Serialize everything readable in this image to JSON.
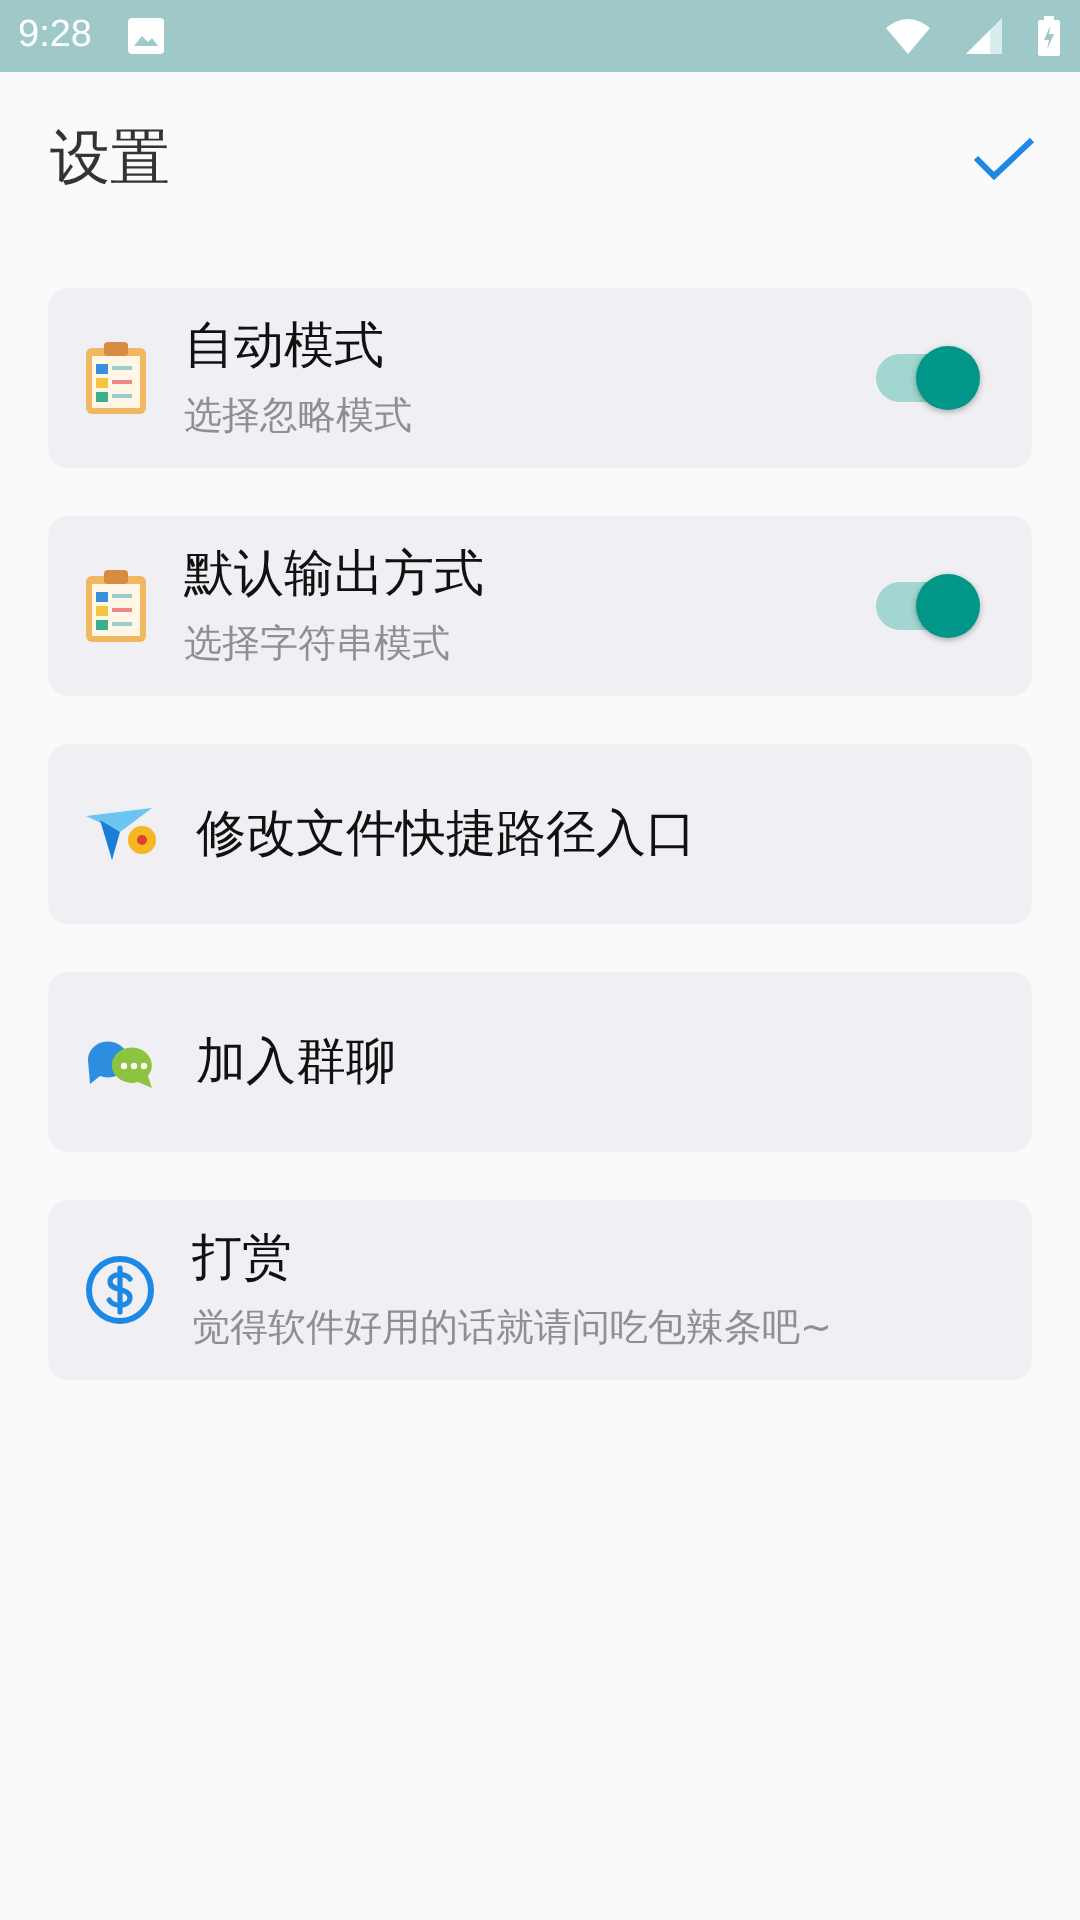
{
  "status_bar": {
    "time": "9:28"
  },
  "header": {
    "title": "设置"
  },
  "items": [
    {
      "kind": "toggle",
      "title": "自动模式",
      "subtitle": "选择忽略模式",
      "on": true
    },
    {
      "kind": "toggle",
      "title": "默认输出方式",
      "subtitle": "选择字符串模式",
      "on": true
    },
    {
      "kind": "link",
      "title": "修改文件快捷路径入口"
    },
    {
      "kind": "link",
      "title": "加入群聊"
    },
    {
      "kind": "link",
      "title": "打赏",
      "subtitle": "觉得软件好用的话就请问吃包辣条吧~"
    }
  ]
}
